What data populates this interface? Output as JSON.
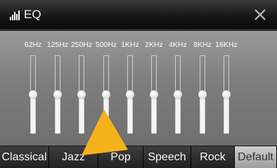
{
  "header": {
    "icon": "equalizer-bars-icon",
    "title": "EQ",
    "close_icon": "close-icon"
  },
  "bands": [
    {
      "label": "62Hz",
      "level": 0.5
    },
    {
      "label": "125Hz",
      "level": 0.5
    },
    {
      "label": "250Hz",
      "level": 0.5
    },
    {
      "label": "500Hz",
      "level": 0.5
    },
    {
      "label": "1KHz",
      "level": 0.5
    },
    {
      "label": "2KHz",
      "level": 0.5
    },
    {
      "label": "4KHz",
      "level": 0.5
    },
    {
      "label": "8KHz",
      "level": 0.5
    },
    {
      "label": "16KHz",
      "level": 0.5
    }
  ],
  "presets": [
    {
      "label": "Classical",
      "active": false
    },
    {
      "label": "Jazz",
      "active": false
    },
    {
      "label": "Pop",
      "active": false
    },
    {
      "label": "Speech",
      "active": false
    },
    {
      "label": "Rock",
      "active": false
    },
    {
      "label": "Default",
      "active": true
    }
  ],
  "colors": {
    "arrow": "#f5b21a",
    "active_preset": "#b8b8b8"
  }
}
